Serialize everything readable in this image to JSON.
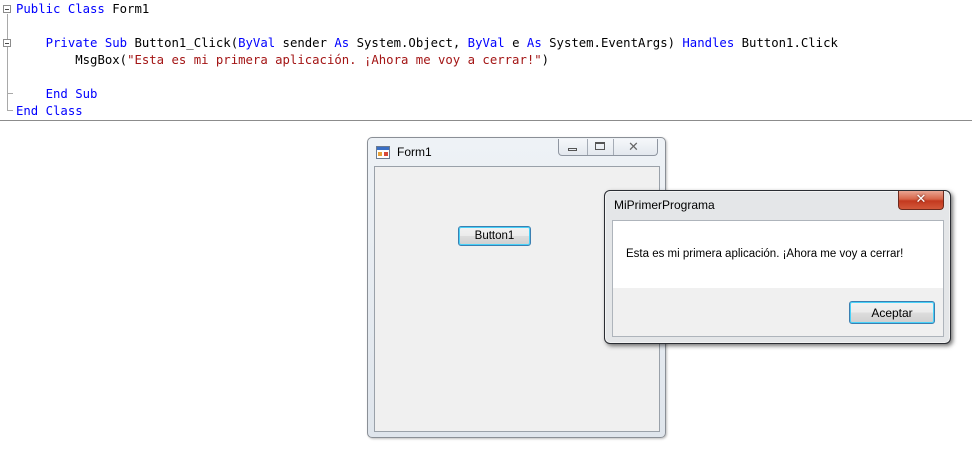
{
  "editor": {
    "lines": [
      {
        "kw1": "Public Class",
        "rest": " Form1"
      },
      {
        "blank": ""
      },
      {
        "indent": "    ",
        "kw1": "Private Sub",
        "mid1": " Button1_Click(",
        "kw2": "ByVal",
        "mid2": " sender ",
        "kw3": "As",
        "mid3": " System.Object, ",
        "kw4": "ByVal",
        "mid4": " e ",
        "kw5": "As",
        "mid5": " System.EventArgs) ",
        "kw6": "Handles",
        "mid6": " Button1.Click"
      },
      {
        "indent": "        ",
        "call": "MsgBox(",
        "str": "\"Esta es mi primera aplicación. ¡Ahora me voy a cerrar!\"",
        "close": ")"
      },
      {
        "blank": ""
      },
      {
        "indent": "    ",
        "kw1": "End Sub"
      },
      {
        "kw1": "End Class"
      }
    ],
    "colors": {
      "keyword": "#0000ff",
      "string": "#a31515"
    }
  },
  "form1": {
    "title": "Form1",
    "icon": "form-app-icon",
    "button_label": "Button1"
  },
  "msgbox": {
    "title": "MiPrimerPrograma",
    "message": "Esta es mi primera aplicación. ¡Ahora me voy a cerrar!",
    "ok_label": "Aceptar",
    "close_glyph": "✕"
  }
}
